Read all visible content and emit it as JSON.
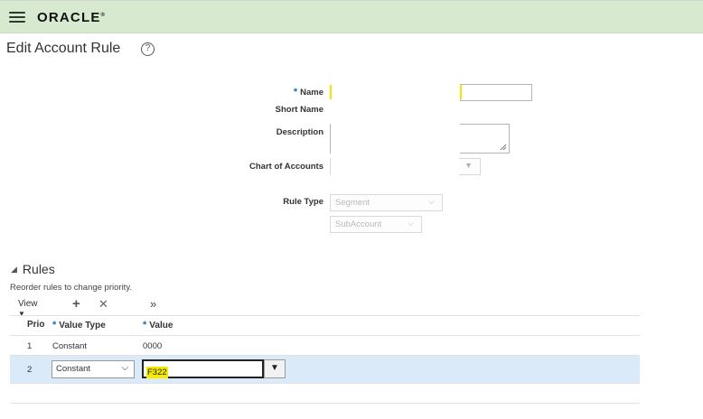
{
  "header": {
    "menu_icon": "hamburger-menu-icon",
    "logo_text": "ORACLE",
    "logo_mark": "®"
  },
  "page": {
    "title": "Edit Account Rule",
    "help_icon": "?"
  },
  "form": {
    "name_required": "*",
    "name_label": "Name",
    "short_name_label": "Short Name",
    "description_label": "Description",
    "chart_of_accounts_label": "Chart of Accounts",
    "rule_type_label": "Rule Type",
    "rule_type_value": "Segment",
    "segment_value": "SubAccount"
  },
  "rules": {
    "title": "Rules",
    "hint": "Reorder rules to change priority.",
    "toolbar": {
      "view_label": "View",
      "add_icon": "+",
      "delete_icon": "✕",
      "more_icon": "»"
    },
    "columns": {
      "priority": "Prio",
      "value_type_required": "*",
      "value_type": "Value Type",
      "value_required": "*",
      "value": "Value"
    },
    "rows": [
      {
        "priority": "1",
        "value_type": "Constant",
        "value": "0000"
      },
      {
        "priority": "2",
        "value_type": "Constant",
        "value": "F322"
      }
    ]
  },
  "colors": {
    "header_bg": "#d7ead0",
    "selected_row": "#dbeaf8",
    "highlight": "#f6ea00",
    "required_star": "#1a6fb0"
  }
}
